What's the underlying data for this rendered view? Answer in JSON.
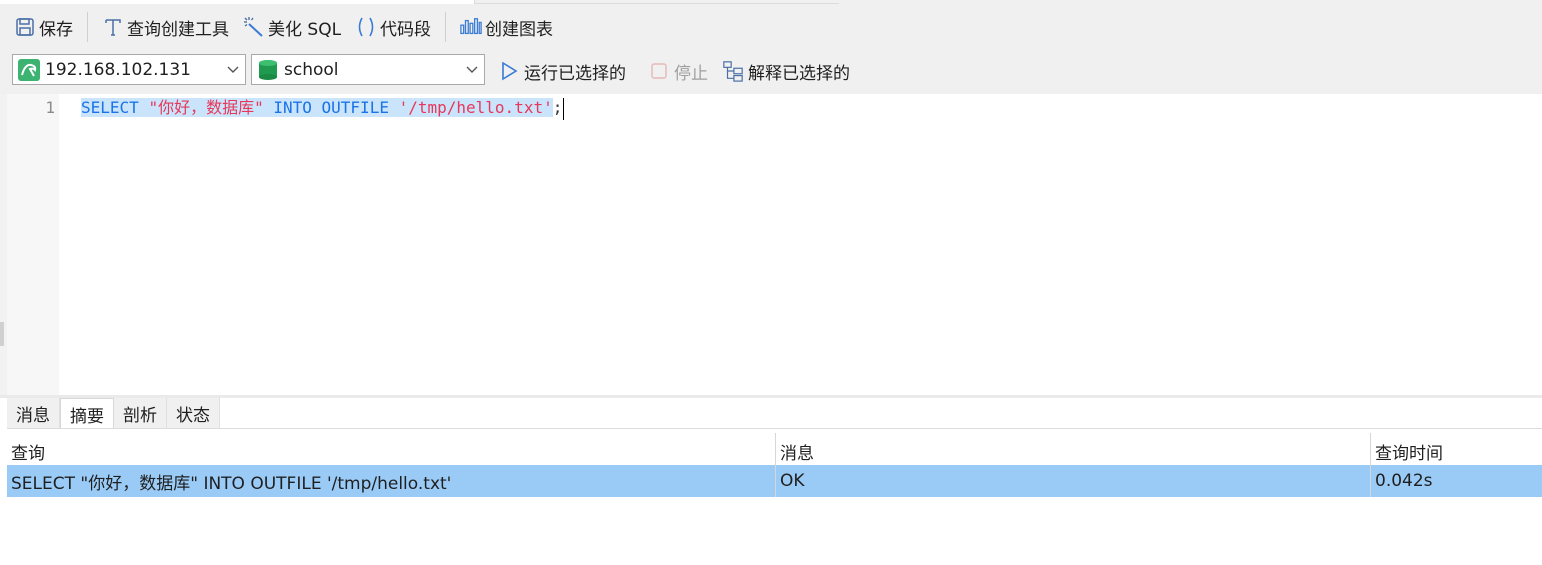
{
  "toolbar": {
    "save": "保存",
    "query_builder": "查询创建工具",
    "beautify_sql": "美化 SQL",
    "code_snippet": "代码段",
    "create_chart": "创建图表"
  },
  "connection": {
    "host": "192.168.102.131",
    "database": "school"
  },
  "actions": {
    "run_selected": "运行已选择的",
    "stop": "停止",
    "explain_selected": "解释已选择的"
  },
  "editor": {
    "line_number": "1",
    "code": {
      "kw_select": "SELECT",
      "str_value": "\"你好，数据库\"",
      "kw_into": "INTO OUTFILE",
      "str_path": "'/tmp/hello.txt'",
      "terminator": ";"
    }
  },
  "result_tabs": [
    "消息",
    "摘要",
    "剖析",
    "状态"
  ],
  "summary_table": {
    "headers": [
      "查询",
      "消息",
      "查询时间"
    ],
    "rows": [
      [
        "SELECT \"你好，数据库\" INTO OUTFILE '/tmp/hello.txt'",
        "OK",
        "0.042s"
      ]
    ]
  },
  "colors": {
    "keyword": "#1a73e8",
    "string": "#e8375a",
    "selection": "#c9e4fb",
    "selected_row": "#9acbf7"
  }
}
